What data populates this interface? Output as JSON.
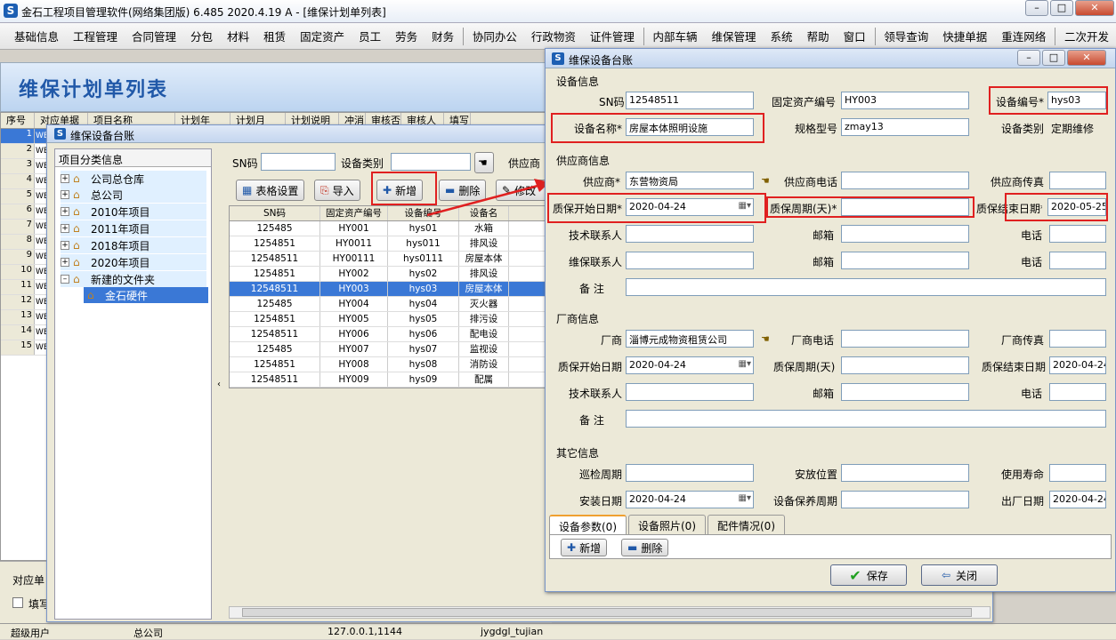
{
  "app": {
    "title": "金石工程项目管理软件(网络集团版) 6.485  2020.4.19 A - [维保计划单列表]",
    "logo": "S"
  },
  "menu": [
    "基础信息",
    "工程管理",
    "合同管理",
    "分包",
    "材料",
    "租赁",
    "固定资产",
    "员工",
    "劳务",
    "财务",
    "|",
    "协同办公",
    "行政物资",
    "证件管理",
    "|",
    "内部车辆",
    "维保管理",
    "系统",
    "帮助",
    "窗口",
    "|",
    "领导查询",
    "快捷单据",
    "重连网络",
    "|",
    "二次开发"
  ],
  "banner": {
    "title": "维保计划单列表"
  },
  "bg_table": {
    "headers": [
      "序号",
      "对应单据",
      "项目名称",
      "计划年",
      "计划月",
      "计划说明",
      "冲消",
      "审核否",
      "审核人",
      "填写"
    ],
    "rows": [
      {
        "n": "1",
        "w": "WE"
      },
      {
        "n": "2",
        "w": "WE"
      },
      {
        "n": "3",
        "w": "WE"
      },
      {
        "n": "4",
        "w": "WE"
      },
      {
        "n": "5",
        "w": "WE"
      },
      {
        "n": "6",
        "w": "WE"
      },
      {
        "n": "7",
        "w": "WE"
      },
      {
        "n": "8",
        "w": "WE"
      },
      {
        "n": "9",
        "w": "WE"
      },
      {
        "n": "10",
        "w": "WE"
      },
      {
        "n": "11",
        "w": "WE"
      },
      {
        "n": "12",
        "w": "WE"
      },
      {
        "n": "13",
        "w": "WE"
      },
      {
        "n": "14",
        "w": "WE"
      },
      {
        "n": "15",
        "w": "WE"
      }
    ],
    "bottom_label": "对应单",
    "bottom_check": "填写"
  },
  "status": {
    "user": "超级用户",
    "company": "总公司",
    "ip": "127.0.0.1,1144",
    "db": "jygdgl_tujian"
  },
  "dlg1": {
    "title": "维保设备台账",
    "tree_header": "项目分类信息",
    "tree": [
      "公司总仓库",
      "总公司",
      "2010年项目",
      "2011年项目",
      "2018年项目",
      "2020年项目",
      "新建的文件夹",
      "金石硬件"
    ],
    "filter": {
      "sn_label": "SN码",
      "sn_value": "",
      "type_label": "设备类别",
      "type_value": "",
      "supplier_label": "供应商"
    },
    "toolbar": {
      "grid_settings": "表格设置",
      "import": "导入",
      "add": "新增",
      "delete": "删除",
      "edit": "修改"
    },
    "grid_headers": [
      "SN码",
      "固定资产编号",
      "设备编号",
      "设备名"
    ],
    "grid_rows": [
      [
        "125485",
        "HY001",
        "hys01",
        "水箱"
      ],
      [
        "1254851",
        "HY0011",
        "hys011",
        "排风设"
      ],
      [
        "12548511",
        "HY00111",
        "hys0111",
        "房屋本体"
      ],
      [
        "1254851",
        "HY002",
        "hys02",
        "排风设"
      ],
      [
        "12548511",
        "HY003",
        "hys03",
        "房屋本体"
      ],
      [
        "125485",
        "HY004",
        "hys04",
        "灭火器"
      ],
      [
        "1254851",
        "HY005",
        "hys05",
        "排污设"
      ],
      [
        "12548511",
        "HY006",
        "hys06",
        "配电设"
      ],
      [
        "125485",
        "HY007",
        "hys07",
        "监视设"
      ],
      [
        "1254851",
        "HY008",
        "hys08",
        "消防设"
      ],
      [
        "12548511",
        "HY009",
        "hys09",
        "配属"
      ]
    ],
    "selected_row": 4
  },
  "dlg2": {
    "title": "维保设备台账",
    "sec_device": "设备信息",
    "sec_supplier": "供应商信息",
    "sec_vendor": "厂商信息",
    "sec_other": "其它信息",
    "labels": {
      "sn": "SN码",
      "asset_no": "固定资产编号",
      "device_no": "设备编号*",
      "device_name": "设备名称*",
      "model": "规格型号",
      "category": "设备类别",
      "supplier": "供应商*",
      "supplier_phone": "供应商电话",
      "supplier_fax": "供应商传真",
      "warranty_start": "质保开始日期*",
      "warranty_period": "质保周期(天)*",
      "warranty_end": "质保结束日期*",
      "tech_contact": "技术联系人",
      "email": "邮箱",
      "phone": "电话",
      "maint_contact": "维保联系人",
      "remark": "备    注",
      "vendor": "厂商",
      "vendor_phone": "厂商电话",
      "vendor_fax": "厂商传真",
      "v_warranty_start": "质保开始日期",
      "v_warranty_period": "质保周期(天)",
      "v_warranty_end": "质保结束日期",
      "patrol_cycle": "巡检周期",
      "location": "安放位置",
      "lifetime": "使用寿命",
      "install_date": "安装日期",
      "maint_cycle": "设备保养周期",
      "factory_date": "出厂日期"
    },
    "values": {
      "sn": "12548511",
      "asset_no": "HY003",
      "device_no": "hys03",
      "device_name": "房屋本体照明设施",
      "model": "zmay13",
      "category": "定期维修",
      "supplier": "东营物资局",
      "supplier_phone": "",
      "supplier_fax": "",
      "warranty_start": "2020-04-24",
      "warranty_period": "",
      "warranty_end": "2020-05-25",
      "vendor": "淄博元成物资租赁公司",
      "v_warranty_start": "2020-04-24",
      "v_warranty_end": "2020-04-24",
      "install_date": "2020-04-24",
      "factory_date": "2020-04-24"
    },
    "tabs": [
      "设备参数(0)",
      "设备照片(0)",
      "配件情况(0)"
    ],
    "tab_add": "新增",
    "tab_delete": "删除",
    "save": "保存",
    "close": "关闭"
  },
  "colors": {
    "accent": "#3a78d6",
    "highlight": "#e02020",
    "title_blue": "#2058a8"
  }
}
